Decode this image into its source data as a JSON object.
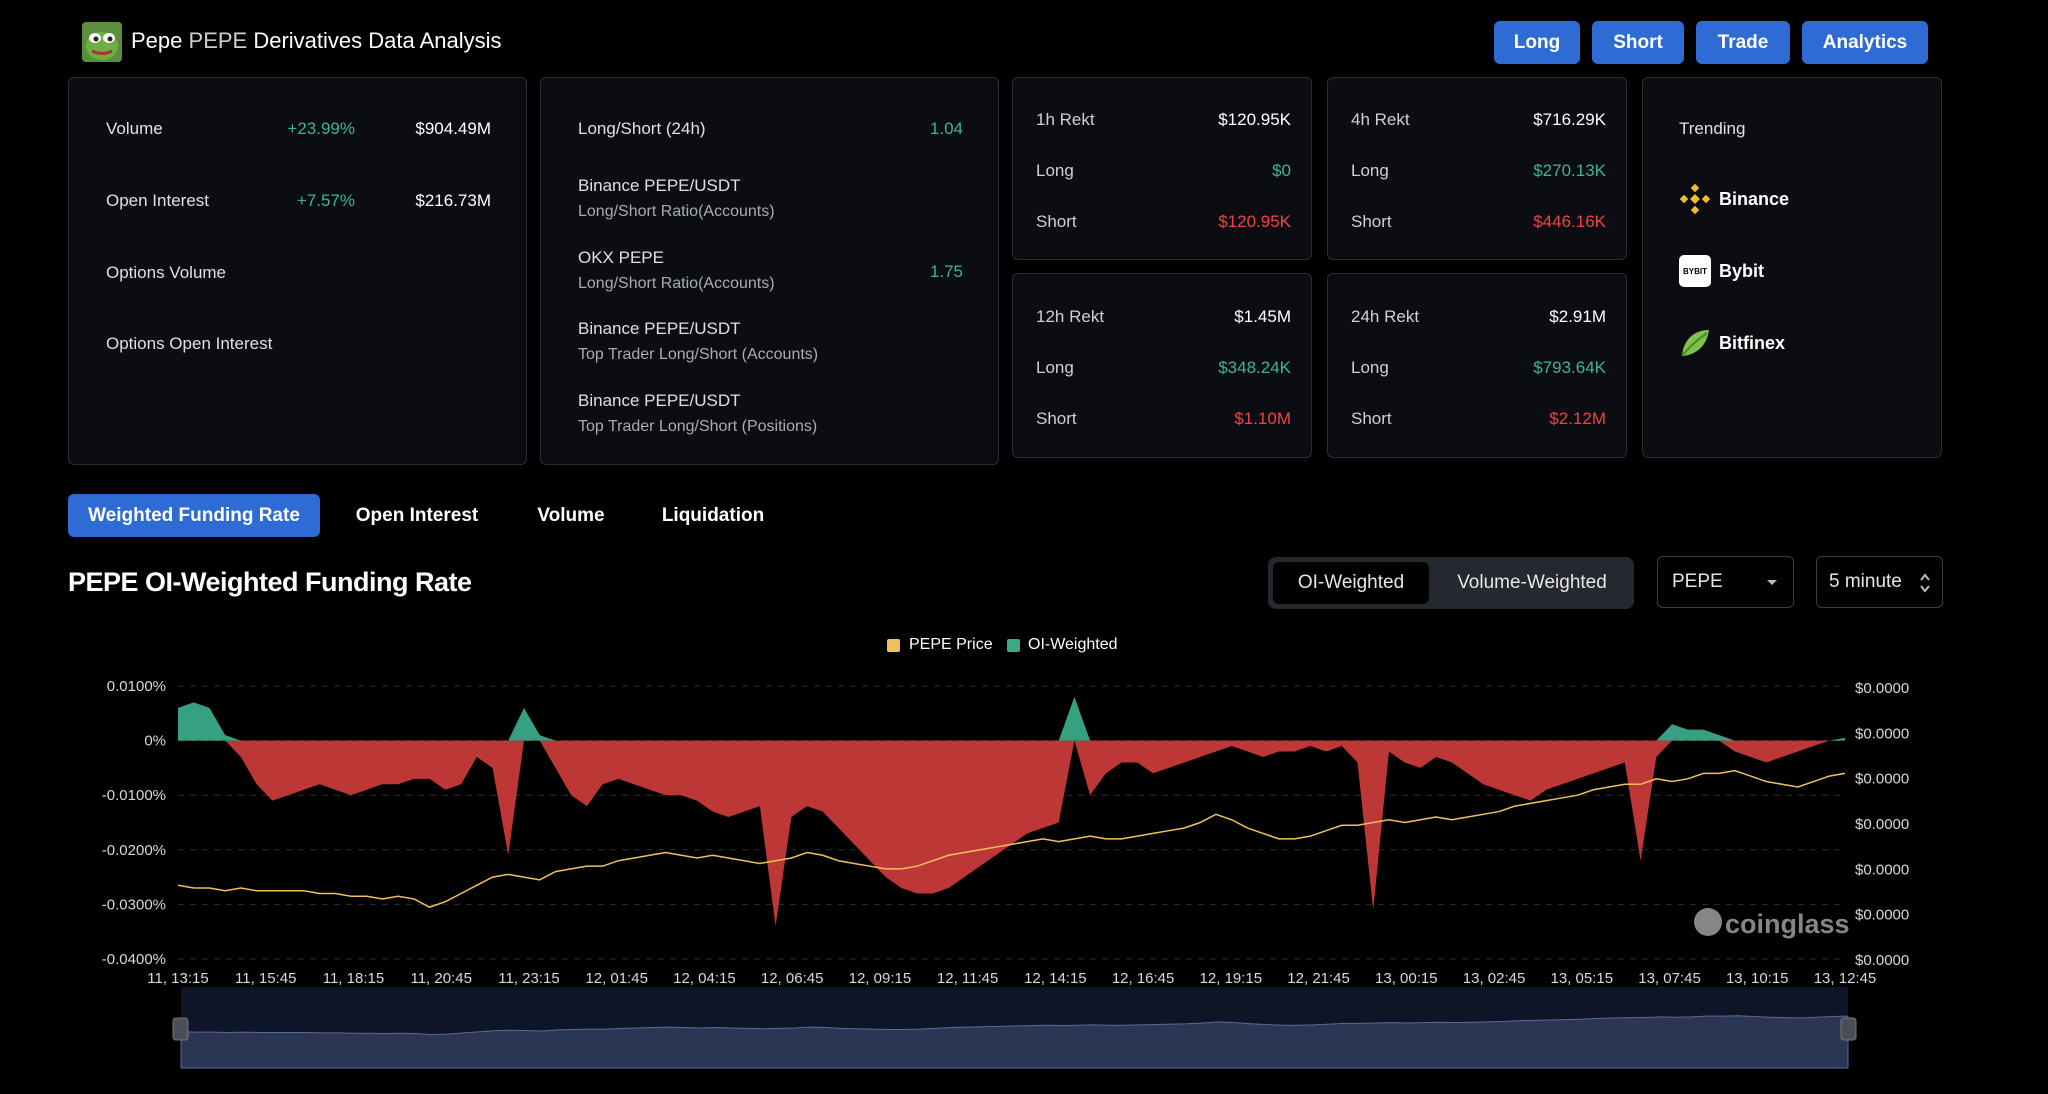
{
  "header": {
    "title_name": "Pepe",
    "title_symbol": "PEPE",
    "title_rest": "Derivatives Data Analysis",
    "nav": [
      "Long",
      "Short",
      "Trade",
      "Analytics"
    ]
  },
  "summary": {
    "volume": {
      "label": "Volume",
      "change": "+23.99%",
      "value": "$904.49M"
    },
    "open_interest": {
      "label": "Open Interest",
      "change": "+7.57%",
      "value": "$216.73M"
    },
    "options_volume": {
      "label": "Options Volume"
    },
    "options_open_interest": {
      "label": "Options Open Interest"
    }
  },
  "long_short": {
    "title": "Long/Short (24h)",
    "title_value": "1.04",
    "rows": [
      {
        "label": "Binance PEPE/USDT",
        "sub": "Long/Short Ratio(Accounts)",
        "value": ""
      },
      {
        "label": "OKX PEPE",
        "sub": "Long/Short Ratio(Accounts)",
        "value": "1.75"
      },
      {
        "label": "Binance PEPE/USDT",
        "sub": "Top Trader Long/Short (Accounts)",
        "value": ""
      },
      {
        "label": "Binance PEPE/USDT",
        "sub": "Top Trader Long/Short (Positions)",
        "value": ""
      }
    ]
  },
  "rekt": [
    {
      "title": "1h Rekt",
      "total": "$120.95K",
      "long_label": "Long",
      "long": "$0",
      "short_label": "Short",
      "short": "$120.95K"
    },
    {
      "title": "4h Rekt",
      "total": "$716.29K",
      "long_label": "Long",
      "long": "$270.13K",
      "short_label": "Short",
      "short": "$446.16K"
    },
    {
      "title": "12h Rekt",
      "total": "$1.45M",
      "long_label": "Long",
      "long": "$348.24K",
      "short_label": "Short",
      "short": "$1.10M"
    },
    {
      "title": "24h Rekt",
      "total": "$2.91M",
      "long_label": "Long",
      "long": "$793.64K",
      "short_label": "Short",
      "short": "$2.12M"
    }
  ],
  "trending": {
    "title": "Trending",
    "items": [
      {
        "name": "Binance",
        "icon": "binance-icon"
      },
      {
        "name": "Bybit",
        "icon": "bybit-icon",
        "icon_text": "BYBIT"
      },
      {
        "name": "Bitfinex",
        "icon": "bitfinex-icon"
      }
    ]
  },
  "tabs": [
    "Weighted Funding Rate",
    "Open Interest",
    "Volume",
    "Liquidation"
  ],
  "chart_section": {
    "title": "PEPE OI-Weighted Funding Rate",
    "toggle": [
      "OI-Weighted",
      "Volume-Weighted"
    ],
    "toggle_selected": "OI-Weighted",
    "symbol_select": "PEPE",
    "interval_select": "5 minute",
    "watermark": "coinglass",
    "colors": {
      "price": "#f0c05a",
      "positive": "#3aa98a",
      "negative": "#c83a3a",
      "navigator": "#2b3554"
    }
  },
  "chart_data": {
    "type": "area",
    "legend": [
      "PEPE Price",
      "OI-Weighted"
    ],
    "legend_position": "top-center",
    "y_left_ticks": [
      "0.0100%",
      "0%",
      "-0.0100%",
      "-0.0200%",
      "-0.0300%",
      "-0.0400%"
    ],
    "y_right_ticks": [
      "$0.0000",
      "$0.0000",
      "$0.0000",
      "$0.0000",
      "$0.0000",
      "$0.0000",
      "$0.0000"
    ],
    "x_ticks": [
      "11, 13:15",
      "11, 15:45",
      "11, 18:15",
      "11, 20:45",
      "11, 23:15",
      "12, 01:45",
      "12, 04:15",
      "12, 06:45",
      "12, 09:15",
      "12, 11:45",
      "12, 14:15",
      "12, 16:45",
      "12, 19:15",
      "12, 21:45",
      "13, 00:15",
      "13, 02:45",
      "13, 05:15",
      "13, 07:45",
      "13, 10:15",
      "13, 12:45"
    ],
    "ylim_left": [
      -0.04,
      0.01
    ],
    "grid": true,
    "series": [
      {
        "name": "OI-Weighted",
        "unit": "%",
        "values": [
          0.006,
          0.007,
          0.006,
          0.001,
          -0.003,
          -0.008,
          -0.011,
          -0.01,
          -0.009,
          -0.008,
          -0.009,
          -0.01,
          -0.009,
          -0.008,
          -0.008,
          -0.007,
          -0.007,
          -0.009,
          -0.008,
          -0.003,
          -0.005,
          -0.021,
          0.006,
          0.001,
          -0.005,
          -0.01,
          -0.012,
          -0.008,
          -0.007,
          -0.008,
          -0.009,
          -0.01,
          -0.01,
          -0.011,
          -0.013,
          -0.014,
          -0.013,
          -0.012,
          -0.034,
          -0.014,
          -0.012,
          -0.013,
          -0.016,
          -0.019,
          -0.022,
          -0.025,
          -0.027,
          -0.028,
          -0.028,
          -0.027,
          -0.025,
          -0.023,
          -0.021,
          -0.019,
          -0.017,
          -0.016,
          -0.015,
          0.008,
          -0.01,
          -0.006,
          -0.004,
          -0.004,
          -0.006,
          -0.005,
          -0.004,
          -0.003,
          -0.002,
          -0.001,
          -0.002,
          -0.003,
          -0.002,
          -0.002,
          -0.001,
          -0.002,
          -0.001,
          -0.004,
          -0.031,
          -0.002,
          -0.004,
          -0.005,
          -0.003,
          -0.004,
          -0.006,
          -0.008,
          -0.009,
          -0.01,
          -0.011,
          -0.009,
          -0.008,
          -0.007,
          -0.006,
          -0.005,
          -0.004,
          -0.022,
          -0.003,
          0.003,
          0.002,
          0.002,
          0.001,
          -0.002,
          -0.003,
          -0.004,
          -0.003,
          -0.002,
          -0.001,
          0.0,
          0.0005
        ]
      },
      {
        "name": "PEPE Price",
        "unit": "$",
        "values": [
          0.27,
          0.26,
          0.26,
          0.25,
          0.26,
          0.25,
          0.25,
          0.25,
          0.25,
          0.24,
          0.24,
          0.23,
          0.23,
          0.22,
          0.23,
          0.22,
          0.19,
          0.21,
          0.24,
          0.27,
          0.3,
          0.31,
          0.3,
          0.29,
          0.32,
          0.33,
          0.34,
          0.34,
          0.36,
          0.37,
          0.38,
          0.39,
          0.38,
          0.37,
          0.38,
          0.37,
          0.36,
          0.35,
          0.36,
          0.37,
          0.39,
          0.38,
          0.36,
          0.35,
          0.34,
          0.33,
          0.33,
          0.34,
          0.36,
          0.38,
          0.39,
          0.4,
          0.41,
          0.42,
          0.43,
          0.44,
          0.43,
          0.44,
          0.45,
          0.44,
          0.44,
          0.45,
          0.46,
          0.47,
          0.48,
          0.5,
          0.53,
          0.51,
          0.48,
          0.46,
          0.44,
          0.44,
          0.45,
          0.47,
          0.49,
          0.49,
          0.5,
          0.51,
          0.5,
          0.51,
          0.52,
          0.51,
          0.52,
          0.53,
          0.54,
          0.56,
          0.57,
          0.58,
          0.59,
          0.6,
          0.62,
          0.63,
          0.64,
          0.64,
          0.66,
          0.65,
          0.66,
          0.68,
          0.68,
          0.69,
          0.67,
          0.65,
          0.64,
          0.63,
          0.65,
          0.67,
          0.68
        ]
      }
    ]
  }
}
